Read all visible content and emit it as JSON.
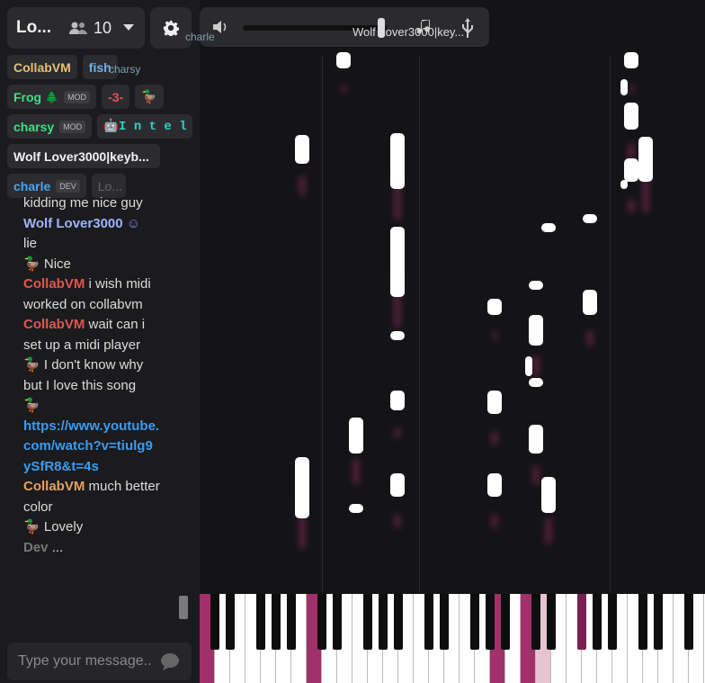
{
  "top": {
    "title": "Lo...",
    "user_count": "10"
  },
  "users": [
    [
      {
        "name": "CollabVM",
        "color": "#e6c074"
      },
      {
        "name": "fish",
        "color": "#6db3e6"
      }
    ],
    [
      {
        "name": "Frog",
        "badge": "MOD",
        "color": "#3ee07f",
        "extra": "🌲"
      },
      {
        "name": "-3-",
        "color": "#e05555"
      },
      {
        "name": "🦆",
        "color": "#ccc"
      }
    ],
    [
      {
        "name": "charsy",
        "badge": "MOD",
        "color": "#3ee07f"
      },
      {
        "name": "🤖I n t e l",
        "color": "#2dd2c8"
      }
    ],
    [
      {
        "name": "Wolf Lover3000|keyb...",
        "color": "#ffffff"
      }
    ],
    [
      {
        "name": "charle",
        "badge": "DEV",
        "color": "#4aa3f0"
      },
      {
        "name": "Lo...",
        "color": "#666"
      }
    ]
  ],
  "chat": [
    {
      "text": "kidding me nice guy"
    },
    {
      "user": "Wolf Lover3000",
      "user_color": "#9db4ff",
      "icon": "discord-icon"
    },
    {
      "text": "lie"
    },
    {
      "user": "🦆",
      "text": "Nice",
      "user_color": "#ddd"
    },
    {
      "user": "CollabVM",
      "user_color": "#e0574f",
      "text": "i wish midi worked on collabvm"
    },
    {
      "user": "CollabVM",
      "user_color": "#e0574f",
      "text": "wait can i set up a midi player"
    },
    {
      "user": "🦆",
      "user_color": "#ddd",
      "text": "I don't know why but I love this song"
    },
    {
      "user": "🦆",
      "user_color": "#ddd",
      "text": ""
    },
    {
      "link": "https://www.youtube.com/watch?v=tiulg9ySfR8&t=4s"
    },
    {
      "user": "CollabVM",
      "user_color": "#e6a05f",
      "text": "much better color"
    },
    {
      "user": "🦆",
      "user_color": "#ddd",
      "text": "Lovely"
    },
    {
      "user": "Dev",
      "user_color": "#777",
      "text": "..."
    }
  ],
  "input": {
    "placeholder": "Type your message..."
  },
  "media": {
    "now_playing": "Wolf Lover3000|key..."
  },
  "overlay_names": {
    "a": "charle",
    "b": "charsy",
    "c": "I n t e l",
    "d": "fish"
  }
}
